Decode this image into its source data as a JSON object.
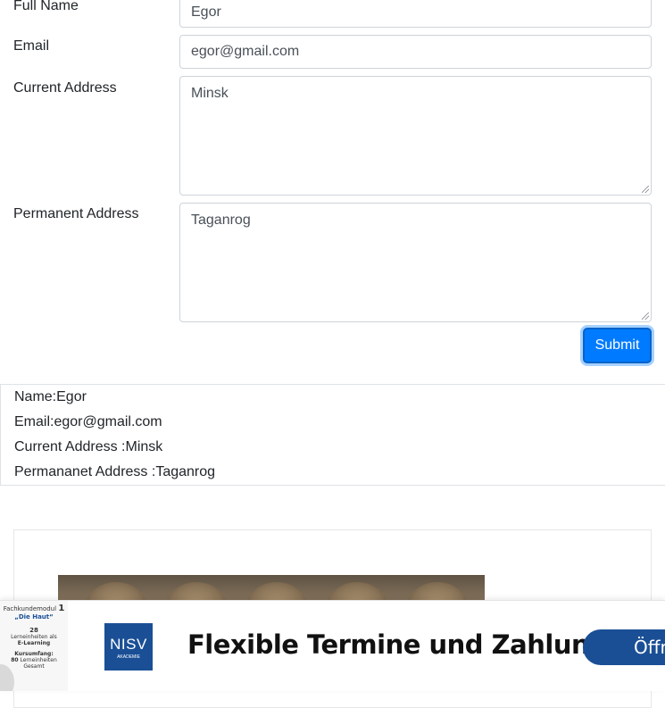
{
  "form": {
    "full_name_label": "Full Name",
    "full_name_value": "Egor",
    "email_label": "Email",
    "email_value": "egor@gmail.com",
    "current_address_label": "Current Address",
    "current_address_value": "Minsk",
    "permanent_address_label": "Permanent Address",
    "permanent_address_value": "Taganrog",
    "submit_label": "Submit"
  },
  "output": {
    "name": "Name:Egor",
    "email": "Email:egor@gmail.com",
    "current_address": "Current Address :Minsk",
    "permanent_address": "Permananet Address :Taganrog"
  },
  "ad": {
    "thumb_line1_prefix": "Fachkundemodul",
    "thumb_line1_num": "1",
    "thumb_line2": "„Die Haut“",
    "thumb_line3": "28",
    "thumb_line4": "Lerneinheiten als",
    "thumb_line5": "E-Learning",
    "thumb_line6": "Kursumfang:",
    "thumb_line7_num": "80",
    "thumb_line7": "Lerneinheiten",
    "thumb_line8": "Gesamt",
    "logo_text": "NISV",
    "logo_subtext": "AKADEMIE",
    "headline": "Flexible Termine und Zahlung",
    "cta_label": "Öffn",
    "brand_color": "#1a4f96"
  }
}
